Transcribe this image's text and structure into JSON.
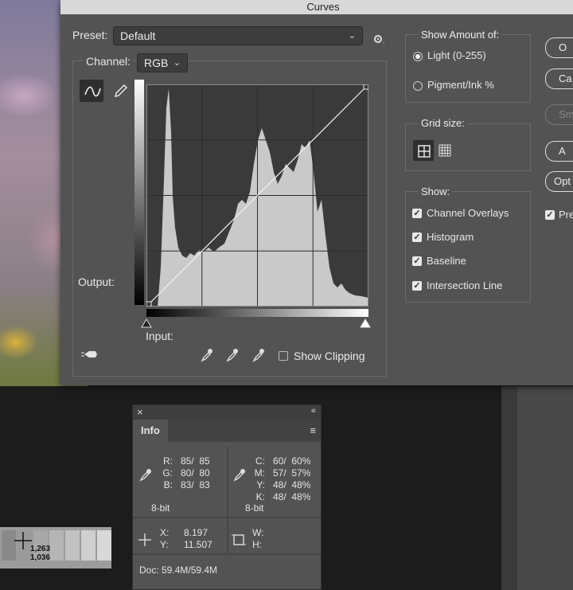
{
  "dialog": {
    "title": "Curves",
    "preset_label": "Preset:",
    "preset_value": "Default",
    "channel_label": "Channel:",
    "channel_value": "RGB",
    "output_label": "Output:",
    "input_label": "Input:",
    "show_clipping_label": "Show Clipping",
    "show_amount": {
      "title": "Show Amount of:",
      "options": [
        {
          "label": "Light  (0-255)",
          "selected": true
        },
        {
          "label": "Pigment/Ink %",
          "selected": false
        }
      ]
    },
    "grid_size": {
      "title": "Grid size:"
    },
    "show": {
      "title": "Show:",
      "items": [
        {
          "label": "Channel Overlays",
          "checked": true
        },
        {
          "label": "Histogram",
          "checked": true
        },
        {
          "label": "Baseline",
          "checked": true
        },
        {
          "label": "Intersection Line",
          "checked": true
        }
      ]
    },
    "side_buttons": [
      "O",
      "Ca",
      "Sm",
      "A",
      "Opt"
    ],
    "preview_label": "Pre"
  },
  "info_panel": {
    "tab": "Info",
    "rgb_labels": "R:\nG:\nB:",
    "rgb_values": "85/  85\n80/  80\n83/  83",
    "cmyk_labels": "C:\nM:\nY:\nK:",
    "cmyk_values": "60/  60%\n57/  57%\n48/  48%\n48/  48%",
    "bit_left": "8-bit",
    "bit_right": "8-bit",
    "xy_labels": "X:\nY:",
    "xy_values": "8.197\n11.507",
    "wh_labels": "W:\nH:",
    "doc": "Doc: 59.4M/59.4M"
  },
  "card": {
    "readout": "1,263\n1,036"
  },
  "colors": {
    "dialog_bg": "#535353",
    "graph_bg": "#3a3a3a",
    "histogram": "#c9c9c9"
  }
}
